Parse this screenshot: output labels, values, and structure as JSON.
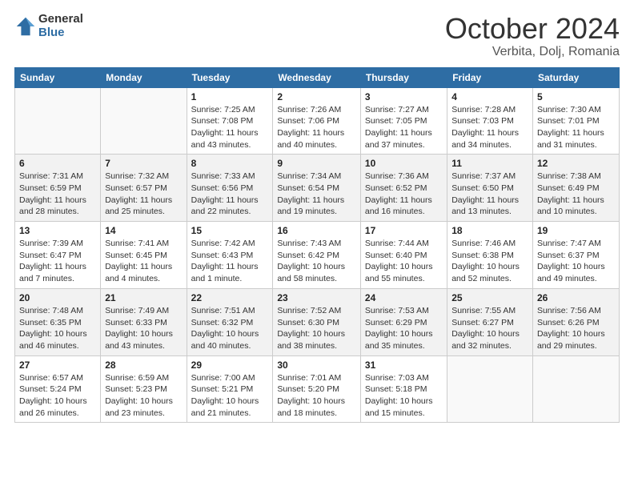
{
  "logo": {
    "general": "General",
    "blue": "Blue"
  },
  "title": "October 2024",
  "location": "Verbita, Dolj, Romania",
  "days_of_week": [
    "Sunday",
    "Monday",
    "Tuesday",
    "Wednesday",
    "Thursday",
    "Friday",
    "Saturday"
  ],
  "weeks": [
    [
      {
        "day": "",
        "info": ""
      },
      {
        "day": "",
        "info": ""
      },
      {
        "day": "1",
        "info": "Sunrise: 7:25 AM\nSunset: 7:08 PM\nDaylight: 11 hours and 43 minutes."
      },
      {
        "day": "2",
        "info": "Sunrise: 7:26 AM\nSunset: 7:06 PM\nDaylight: 11 hours and 40 minutes."
      },
      {
        "day": "3",
        "info": "Sunrise: 7:27 AM\nSunset: 7:05 PM\nDaylight: 11 hours and 37 minutes."
      },
      {
        "day": "4",
        "info": "Sunrise: 7:28 AM\nSunset: 7:03 PM\nDaylight: 11 hours and 34 minutes."
      },
      {
        "day": "5",
        "info": "Sunrise: 7:30 AM\nSunset: 7:01 PM\nDaylight: 11 hours and 31 minutes."
      }
    ],
    [
      {
        "day": "6",
        "info": "Sunrise: 7:31 AM\nSunset: 6:59 PM\nDaylight: 11 hours and 28 minutes."
      },
      {
        "day": "7",
        "info": "Sunrise: 7:32 AM\nSunset: 6:57 PM\nDaylight: 11 hours and 25 minutes."
      },
      {
        "day": "8",
        "info": "Sunrise: 7:33 AM\nSunset: 6:56 PM\nDaylight: 11 hours and 22 minutes."
      },
      {
        "day": "9",
        "info": "Sunrise: 7:34 AM\nSunset: 6:54 PM\nDaylight: 11 hours and 19 minutes."
      },
      {
        "day": "10",
        "info": "Sunrise: 7:36 AM\nSunset: 6:52 PM\nDaylight: 11 hours and 16 minutes."
      },
      {
        "day": "11",
        "info": "Sunrise: 7:37 AM\nSunset: 6:50 PM\nDaylight: 11 hours and 13 minutes."
      },
      {
        "day": "12",
        "info": "Sunrise: 7:38 AM\nSunset: 6:49 PM\nDaylight: 11 hours and 10 minutes."
      }
    ],
    [
      {
        "day": "13",
        "info": "Sunrise: 7:39 AM\nSunset: 6:47 PM\nDaylight: 11 hours and 7 minutes."
      },
      {
        "day": "14",
        "info": "Sunrise: 7:41 AM\nSunset: 6:45 PM\nDaylight: 11 hours and 4 minutes."
      },
      {
        "day": "15",
        "info": "Sunrise: 7:42 AM\nSunset: 6:43 PM\nDaylight: 11 hours and 1 minute."
      },
      {
        "day": "16",
        "info": "Sunrise: 7:43 AM\nSunset: 6:42 PM\nDaylight: 10 hours and 58 minutes."
      },
      {
        "day": "17",
        "info": "Sunrise: 7:44 AM\nSunset: 6:40 PM\nDaylight: 10 hours and 55 minutes."
      },
      {
        "day": "18",
        "info": "Sunrise: 7:46 AM\nSunset: 6:38 PM\nDaylight: 10 hours and 52 minutes."
      },
      {
        "day": "19",
        "info": "Sunrise: 7:47 AM\nSunset: 6:37 PM\nDaylight: 10 hours and 49 minutes."
      }
    ],
    [
      {
        "day": "20",
        "info": "Sunrise: 7:48 AM\nSunset: 6:35 PM\nDaylight: 10 hours and 46 minutes."
      },
      {
        "day": "21",
        "info": "Sunrise: 7:49 AM\nSunset: 6:33 PM\nDaylight: 10 hours and 43 minutes."
      },
      {
        "day": "22",
        "info": "Sunrise: 7:51 AM\nSunset: 6:32 PM\nDaylight: 10 hours and 40 minutes."
      },
      {
        "day": "23",
        "info": "Sunrise: 7:52 AM\nSunset: 6:30 PM\nDaylight: 10 hours and 38 minutes."
      },
      {
        "day": "24",
        "info": "Sunrise: 7:53 AM\nSunset: 6:29 PM\nDaylight: 10 hours and 35 minutes."
      },
      {
        "day": "25",
        "info": "Sunrise: 7:55 AM\nSunset: 6:27 PM\nDaylight: 10 hours and 32 minutes."
      },
      {
        "day": "26",
        "info": "Sunrise: 7:56 AM\nSunset: 6:26 PM\nDaylight: 10 hours and 29 minutes."
      }
    ],
    [
      {
        "day": "27",
        "info": "Sunrise: 6:57 AM\nSunset: 5:24 PM\nDaylight: 10 hours and 26 minutes."
      },
      {
        "day": "28",
        "info": "Sunrise: 6:59 AM\nSunset: 5:23 PM\nDaylight: 10 hours and 23 minutes."
      },
      {
        "day": "29",
        "info": "Sunrise: 7:00 AM\nSunset: 5:21 PM\nDaylight: 10 hours and 21 minutes."
      },
      {
        "day": "30",
        "info": "Sunrise: 7:01 AM\nSunset: 5:20 PM\nDaylight: 10 hours and 18 minutes."
      },
      {
        "day": "31",
        "info": "Sunrise: 7:03 AM\nSunset: 5:18 PM\nDaylight: 10 hours and 15 minutes."
      },
      {
        "day": "",
        "info": ""
      },
      {
        "day": "",
        "info": ""
      }
    ]
  ]
}
